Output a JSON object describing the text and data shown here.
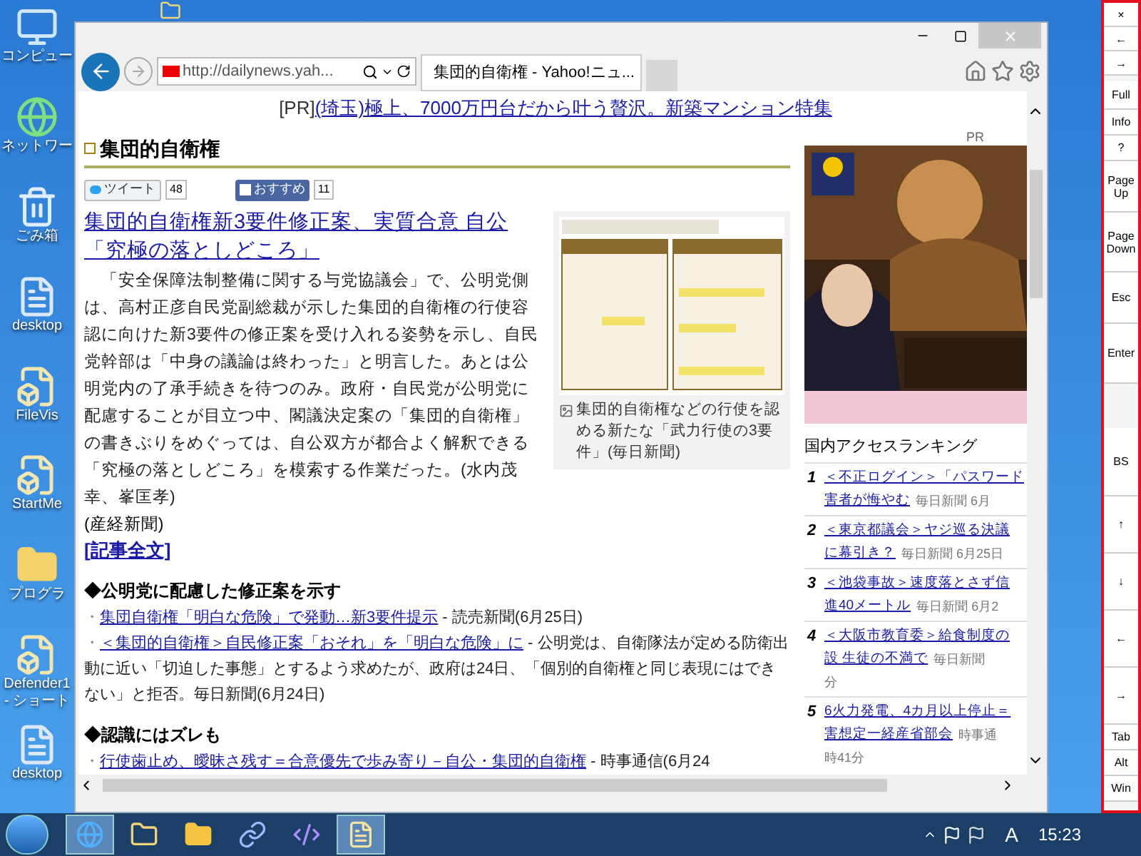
{
  "desktop_icons": [
    {
      "label": "コンピュー",
      "kind": "computer"
    },
    {
      "label": "ネットワー",
      "kind": "network"
    },
    {
      "label": "ごみ箱",
      "kind": "trash"
    },
    {
      "label": "desktop",
      "kind": "file"
    },
    {
      "label": "FileVis",
      "kind": "shortcut"
    },
    {
      "label": "StartMe",
      "kind": "shortcut"
    },
    {
      "label": "プログラ",
      "kind": "folder"
    },
    {
      "label": "Defender1 - ショート",
      "kind": "shortcut"
    },
    {
      "label": "desktop",
      "kind": "file"
    }
  ],
  "window": {
    "address": "http://dailynews.yah...",
    "tabs": [
      {
        "title": "集団的自衛権 - Yahoo!ニュ...",
        "selected": true
      }
    ]
  },
  "page": {
    "pr_banner": {
      "label": "[PR]",
      "link": "(埼玉)極上、7000万円台だから叶う贅沢。新築マンション特集"
    },
    "topic_title": "集団的自衛権",
    "share": [
      {
        "kind": "twitter",
        "label": "ツイート",
        "count": "48"
      },
      {
        "kind": "facebook",
        "label": "おすすめ",
        "count": "11"
      }
    ],
    "headline": "集団的自衛権新3要件修正案、実質合意 自公「究極の落としどころ」",
    "body": "「安全保障法制整備に関する与党協議会」で、公明党側は、高村正彦自民党副総裁が示した集団的自衛権の行使容認に向けた新3要件の修正案を受け入れる姿勢を示し、自民党幹部は「中身の議論は終わった」と明言した。あとは公明党内の了承手続きを待つのみ。政府・自民党が公明党に配慮することが目立つ中、閣議決定案の「集団的自衛権」の書きぶりをめぐっては、自公双方が都合よく解釈できる「究極の落としどころ」を模索する作業だった。(水内茂幸、峯匡孝)",
    "source": "(産経新聞)",
    "full_text_link": "[記事全文]",
    "figure": {
      "kind": "picture",
      "caption": "集団的自衛権などの行使を認める新たな「武力行使の3要件」(毎日新聞)"
    },
    "sections": [
      {
        "heading": "◆公明党に配慮した修正案を示す",
        "items": [
          {
            "bullet": "・",
            "link": "集団自衛権「明白な危険」で発動…新3要件提示",
            "text": " - 読売新聞(6月25日)"
          },
          {
            "bullet": "・",
            "link": "＜集団的自衛権＞自民修正案「おそれ」を「明白な危険」に",
            "text": " - 公明党は、自衛隊法が定める防衛出動に近い「切迫した事態」とするよう求めたが、政府は24日、「個別的自衛権と同じ表現にはできない」と拒否。毎日新聞(6月24日)"
          }
        ]
      },
      {
        "heading": "◆認識にはズレも",
        "items": [
          {
            "bullet": "・",
            "link": "行使歯止め、曖昧さ残す＝合意優先で歩み寄り－自公・集団的自衛権",
            "text": " - 時事通信(6月24"
          }
        ]
      }
    ],
    "sidebar": {
      "pr_label": "PR",
      "ranking_title": "国内アクセスランキング",
      "ranking": [
        {
          "rank": "1",
          "lines": [
            {
              "link": "＜不正ログイン＞「パスワード"
            },
            {
              "link": "害者が悔やむ",
              "meta": "毎日新聞 6月"
            }
          ]
        },
        {
          "rank": "2",
          "lines": [
            {
              "link": "＜東京都議会＞ヤジ巡る決議"
            },
            {
              "link": "に幕引き？",
              "meta": "毎日新聞 6月25日"
            }
          ]
        },
        {
          "rank": "3",
          "lines": [
            {
              "link": "＜池袋事故＞速度落とさず信"
            },
            {
              "link": "進40メートル",
              "meta": "毎日新聞 6月2"
            }
          ]
        },
        {
          "rank": "4",
          "lines": [
            {
              "link": "＜大阪市教育委＞給食制度の"
            },
            {
              "link": "設 生徒の不満で",
              "meta": "毎日新聞"
            },
            {
              "meta": "分"
            }
          ]
        },
        {
          "rank": "5",
          "lines": [
            {
              "link": "6火力発電、4カ月以上停止＝"
            },
            {
              "link": "害想定一経産省部会",
              "meta": "時事通"
            },
            {
              "meta": "時41分"
            }
          ]
        }
      ]
    }
  },
  "right_panel": {
    "buttons": [
      "×",
      "←",
      "→",
      "Full",
      "Info",
      "?",
      "PageUp",
      "PageDown",
      "Esc",
      "Enter",
      "BS",
      "↑",
      "↓",
      "←",
      "→",
      "Tab",
      "Alt",
      "Win"
    ]
  },
  "taskbar": {
    "apps": [
      {
        "kind": "browser",
        "active": true
      },
      {
        "kind": "explorer",
        "active": false
      },
      {
        "kind": "folder",
        "active": false
      },
      {
        "kind": "link",
        "active": false
      },
      {
        "kind": "studio",
        "active": false
      },
      {
        "kind": "document",
        "active": true
      }
    ],
    "ime": "A",
    "clock": "15:23"
  }
}
